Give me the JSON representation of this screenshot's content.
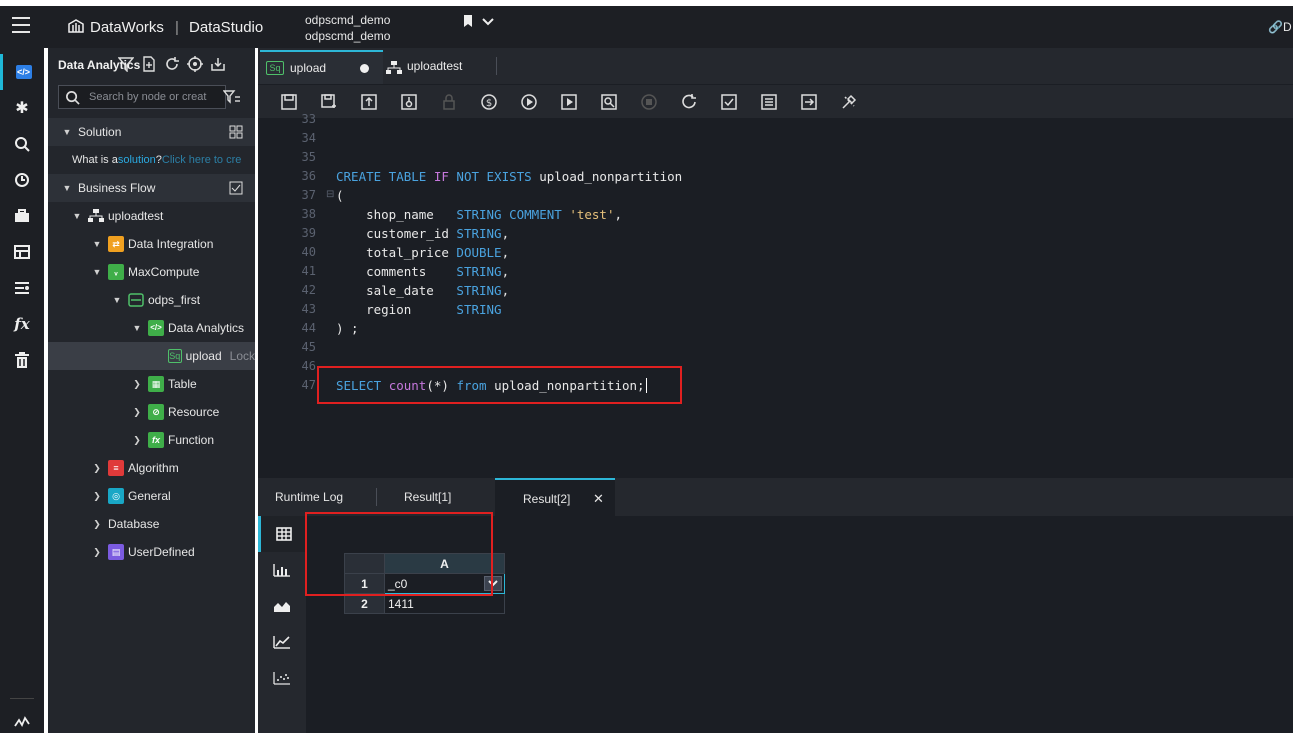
{
  "header": {
    "brand": "DataWorks",
    "separator": "|",
    "module": "DataStudio",
    "project_line1": "odpscmd_demo",
    "project_line2": "odpscmd_demo",
    "right_text": "D"
  },
  "sidebar": {
    "title": "Data Analytics",
    "search_placeholder": "Search by node or creat",
    "solution_section": "Solution",
    "solution_prompt": "What is a ",
    "solution_link": "solution",
    "solution_qmark": "?",
    "solution_cta": "Click here to cre",
    "business_flow_section": "Business Flow",
    "tree": [
      {
        "label": "uploadtest"
      },
      {
        "label": "Data Integration"
      },
      {
        "label": "MaxCompute"
      },
      {
        "label": "odps_first"
      },
      {
        "label": "Data Analytics"
      },
      {
        "label": "upload",
        "suffix": "Lock"
      },
      {
        "label": "Table"
      },
      {
        "label": "Resource"
      },
      {
        "label": "Function"
      },
      {
        "label": "Algorithm"
      },
      {
        "label": "General"
      },
      {
        "label": "Database"
      },
      {
        "label": "UserDefined"
      }
    ]
  },
  "editor": {
    "tabs": [
      {
        "badge": "Sq",
        "label": "upload"
      },
      {
        "label": "uploadtest"
      }
    ],
    "line_numbers": [
      "33",
      "34",
      "35",
      "36",
      "37",
      "38",
      "39",
      "40",
      "41",
      "42",
      "43",
      "44",
      "45",
      "46",
      "47"
    ],
    "code": {
      "l36_a": "CREATE TABLE ",
      "l36_b": "IF",
      "l36_c": " NOT EXISTS ",
      "l36_d": "upload_nonpartition",
      "l37": "(",
      "l38_a": "    shop_name   ",
      "l38_b": "STRING COMMENT ",
      "l38_c": "'test'",
      "l38_d": ",",
      "l39_a": "    customer_id ",
      "l39_b": "STRING",
      "l39_c": ",",
      "l40_a": "    total_price ",
      "l40_b": "DOUBLE",
      "l40_c": ",",
      "l41_a": "    comments    ",
      "l41_b": "STRING",
      "l41_c": ",",
      "l42_a": "    sale_date   ",
      "l42_b": "STRING",
      "l42_c": ",",
      "l43_a": "    region      ",
      "l43_b": "STRING",
      "l44": ") ;",
      "l47_a": "SELECT ",
      "l47_b": "count",
      "l47_c": "(*) ",
      "l47_d": "from",
      "l47_e": " upload_nonpartition;"
    }
  },
  "results": {
    "tabs": [
      "Runtime Log",
      "Result[1]",
      "Result[2]"
    ],
    "close": "✕",
    "column_header": "A",
    "rows": [
      {
        "num": "1",
        "value": "_c0"
      },
      {
        "num": "2",
        "value": "1411"
      }
    ]
  }
}
